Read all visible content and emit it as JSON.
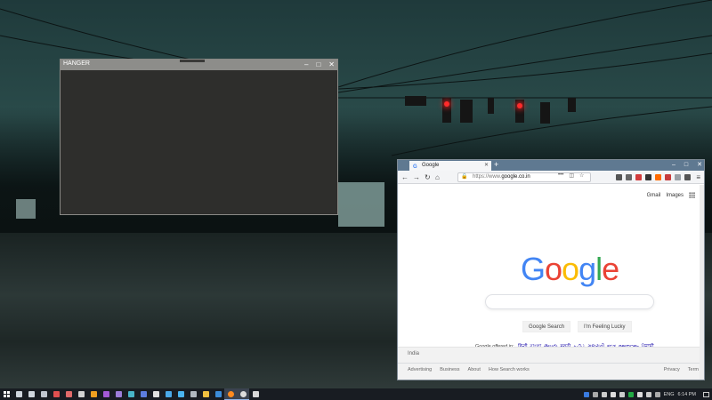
{
  "desktop": {
    "wallpaper": "rainy intersection with traffic lights at dusk"
  },
  "hanger_window": {
    "title": "HANGER",
    "controls": {
      "minimize": "–",
      "maximize": "□",
      "close": "✕"
    }
  },
  "browser": {
    "tab": {
      "title": "Google",
      "favicon": "G",
      "close": "✕"
    },
    "new_tab": "+",
    "window_controls": {
      "minimize": "–",
      "maximize": "□",
      "close": "✕"
    },
    "nav": {
      "back": "←",
      "forward": "→",
      "reload": "↻",
      "home": "⌂"
    },
    "url": {
      "prefix": "https://www.",
      "domain": "google.co.in"
    },
    "url_actions": {
      "more": "•••",
      "pocket": "◫",
      "bookmark": "☆"
    },
    "menu": "≡",
    "toolbar_colors": [
      "#555555",
      "#666666",
      "#d23c3c",
      "#333333",
      "#ff6a00",
      "#c73b3b",
      "#9aa0a6",
      "#555555"
    ]
  },
  "google": {
    "top_links": {
      "gmail": "Gmail",
      "images": "Images"
    },
    "logo_letters": [
      "G",
      "o",
      "o",
      "g",
      "l",
      "e"
    ],
    "search_button": "Google Search",
    "lucky_button": "I'm Feeling Lucky",
    "offered_in": "Google offered in:",
    "languages": [
      "हिन्दी",
      "বাংলা",
      "తెలుగు",
      "मराठी",
      "தமிழ்",
      "ગુજરાતી",
      "ಕನ್ನಡ",
      "മലയാളം",
      "ਪੰਜਾਬੀ"
    ],
    "country": "India",
    "footer_left": [
      "Advertising",
      "Business",
      "About",
      "How Search works"
    ],
    "footer_right": [
      "Privacy",
      "Term"
    ]
  },
  "taskbar": {
    "icons": [
      {
        "name": "search",
        "color": "#cfd6de"
      },
      {
        "name": "task-view",
        "color": "#cfd6de"
      },
      {
        "name": "app-1",
        "color": "#c0c6cf"
      },
      {
        "name": "app-2",
        "color": "#e05050"
      },
      {
        "name": "app-3",
        "color": "#e06a6a"
      },
      {
        "name": "app-4",
        "color": "#d1d1d1"
      },
      {
        "name": "app-5",
        "color": "#f0a020"
      },
      {
        "name": "app-6",
        "color": "#a45ad6"
      },
      {
        "name": "app-7",
        "color": "#9c7cd8"
      },
      {
        "name": "app-8",
        "color": "#48b4c8"
      },
      {
        "name": "app-9",
        "color": "#5d7de0"
      },
      {
        "name": "app-10",
        "color": "#e0e0e0"
      },
      {
        "name": "app-11",
        "color": "#4aa8e8"
      },
      {
        "name": "app-12",
        "color": "#4ab4f0"
      },
      {
        "name": "app-13",
        "color": "#b0b8c0"
      },
      {
        "name": "file-explorer",
        "color": "#f0c040"
      },
      {
        "name": "app-15",
        "color": "#3c8cd8"
      },
      {
        "name": "firefox",
        "color": "#ff8a1f"
      },
      {
        "name": "chrome",
        "color": "#dcdcdc"
      },
      {
        "name": "app-18",
        "color": "#d8d8d8"
      }
    ],
    "tray_colors": [
      "#3a7be0",
      "#aaaaaa",
      "#cccccc",
      "#dddddd",
      "#cccccc",
      "#22aa44",
      "#dddddd",
      "#cccccc",
      "#aaaaaa"
    ],
    "language": "ENG",
    "time": "6:14 PM"
  }
}
